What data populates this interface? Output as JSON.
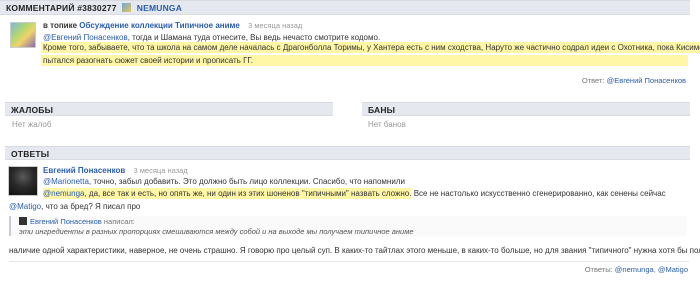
{
  "header": {
    "title": "КОММЕНТАРИЙ #3830277",
    "username": "NEMUNGA"
  },
  "comment": {
    "prefix": "в топике",
    "topic_link": "Обсуждение коллекции Типичное аниме",
    "time": "3 месяца назад",
    "mention": "@Евгений Понасенков",
    "line1_rest": ", тогда и Шамана туда отнесите, Вы ведь нечасто смотрите кодомо.",
    "highlight_line1": "Кроме того, забываете, что та школа на самом деле началась с Драгонболла Торимы, у Хантера есть с ним сходства, Наруто же частично содрал идеи с Охотника, пока Кисимото",
    "highlight_line2": "пытался разогнать сюжет своей истории и прописать ГГ.",
    "reply_label": "Ответ:",
    "reply_user": "@Евгений Понасенков"
  },
  "complaints": {
    "title": "ЖАЛОБЫ",
    "empty": "Нет жалоб"
  },
  "bans": {
    "title": "БАНЫ",
    "empty": "Нет банов"
  },
  "answers": {
    "title": "ОТВЕТЫ",
    "author": "Евгений Понасенков",
    "time": "3 месяца назад",
    "mention1": "@Marionetta",
    "line1_rest": ", точно, забыл добавить. Это должно быть лицо коллекции. Спасибо, что напомнили",
    "mention2": "@nemunga",
    "line2_hl": ", да, все так и есть, но опять же, ни один из этих шоненов \"типичными\" назвать сложно.",
    "line2_rest": " Все не настолько искусственно сгенерированно, как сенены сейчас",
    "mention3": "@Matigo",
    "line3_rest": ", что за бред? Я писал про",
    "quote_author": "Евгений Понасенков",
    "quote_wrote": "написал:",
    "quote_text": "эти ингредиенты в разных пропорциях смешиваются между собой и на выходе мы получаем типичное аниме",
    "line4": "наличие одной характеристики, наверное, не очень страшно. Я говорю про целый суп. В каких-то тайтлах этого меньше, в каких-то больше, но для звания \"типичного\" нужна хотя бы половина",
    "replies_label": "Ответы:",
    "reply_user1": "@nemunga",
    "reply_sep": ",",
    "reply_user2": "@Matigo"
  }
}
